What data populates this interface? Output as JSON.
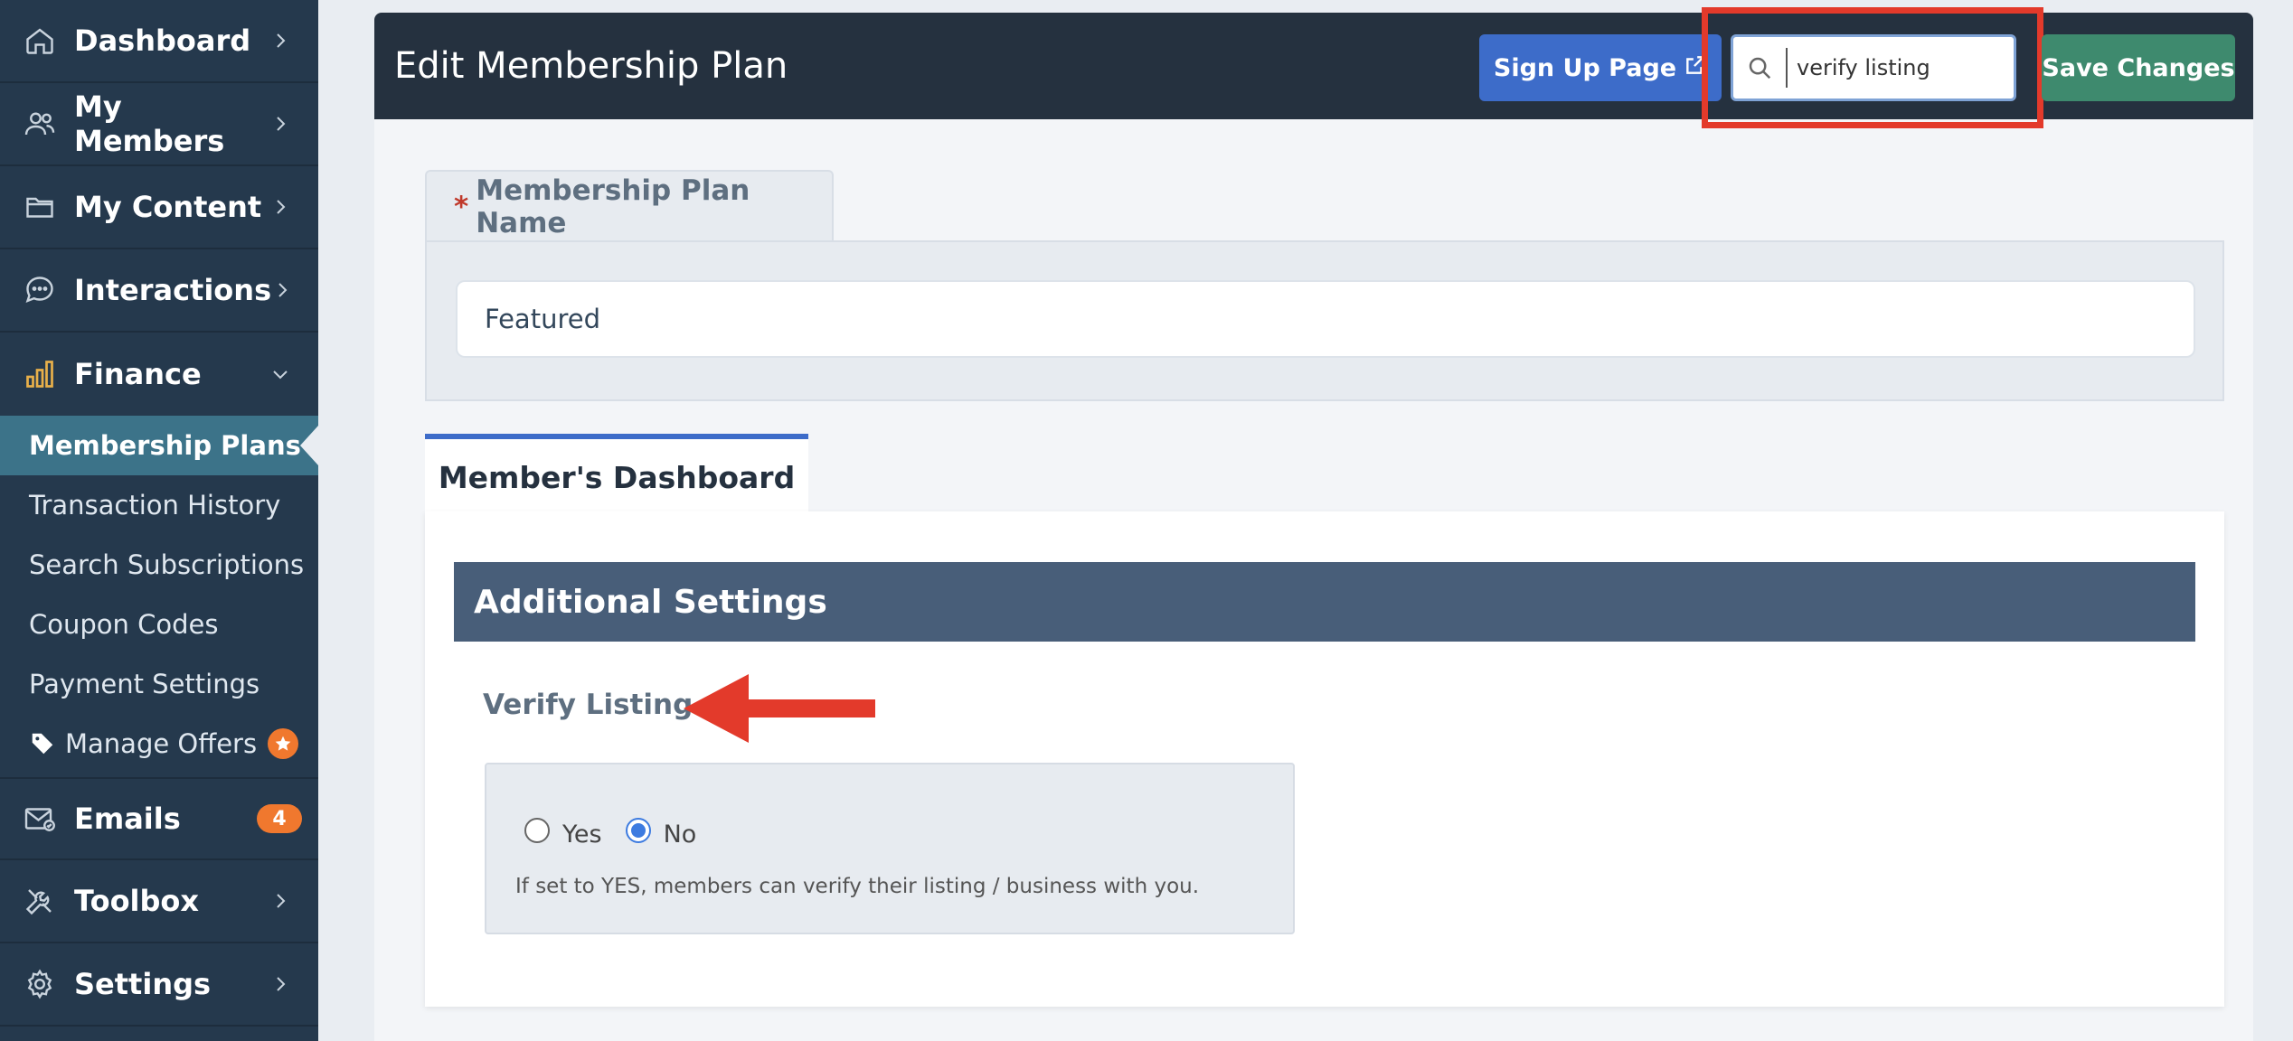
{
  "sidebar": {
    "items_top": [
      {
        "label": "Dashboard",
        "icon": "home-icon"
      },
      {
        "label": "My Members",
        "icon": "users-icon"
      },
      {
        "label": "My Content",
        "icon": "folder-icon"
      },
      {
        "label": "Interactions",
        "icon": "chat-icon"
      },
      {
        "label": "Finance",
        "icon": "bar-chart-icon",
        "expanded": true
      }
    ],
    "finance_sub": [
      {
        "label": "Membership Plans",
        "active": true
      },
      {
        "label": "Transaction History"
      },
      {
        "label": "Search Subscriptions"
      },
      {
        "label": "Coupon Codes"
      },
      {
        "label": "Payment Settings"
      },
      {
        "label": "Manage Offers",
        "icon": "tag-icon",
        "badge_icon": "star-icon"
      }
    ],
    "items_bottom": [
      {
        "label": "Emails",
        "icon": "envelope-icon",
        "badge": "4"
      },
      {
        "label": "Toolbox",
        "icon": "tools-icon"
      },
      {
        "label": "Settings",
        "icon": "gear-icon"
      }
    ]
  },
  "header": {
    "title": "Edit Membership Plan",
    "signup_label": "Sign Up Page",
    "search_value": "verify listing",
    "save_label": "Save Changes"
  },
  "plan_name": {
    "required_mark": "*",
    "label": "Membership Plan Name",
    "value": "Featured"
  },
  "dashboard_tab": {
    "label": "Member's Dashboard",
    "section_title": "Additional Settings",
    "verify": {
      "label": "Verify Listing",
      "options": [
        "Yes",
        "No"
      ],
      "selected": "No",
      "help": "If set to YES, members can verify their listing / business with you."
    }
  },
  "colors": {
    "sidebar_bg": "#25394d",
    "active_item": "#3c7389",
    "topbar_bg": "#25313f",
    "signup_btn": "#3d6cc9",
    "save_btn": "#3e8a6e",
    "highlight": "#e33a2b",
    "section_header": "#485e79",
    "badge": "#f0782e"
  }
}
